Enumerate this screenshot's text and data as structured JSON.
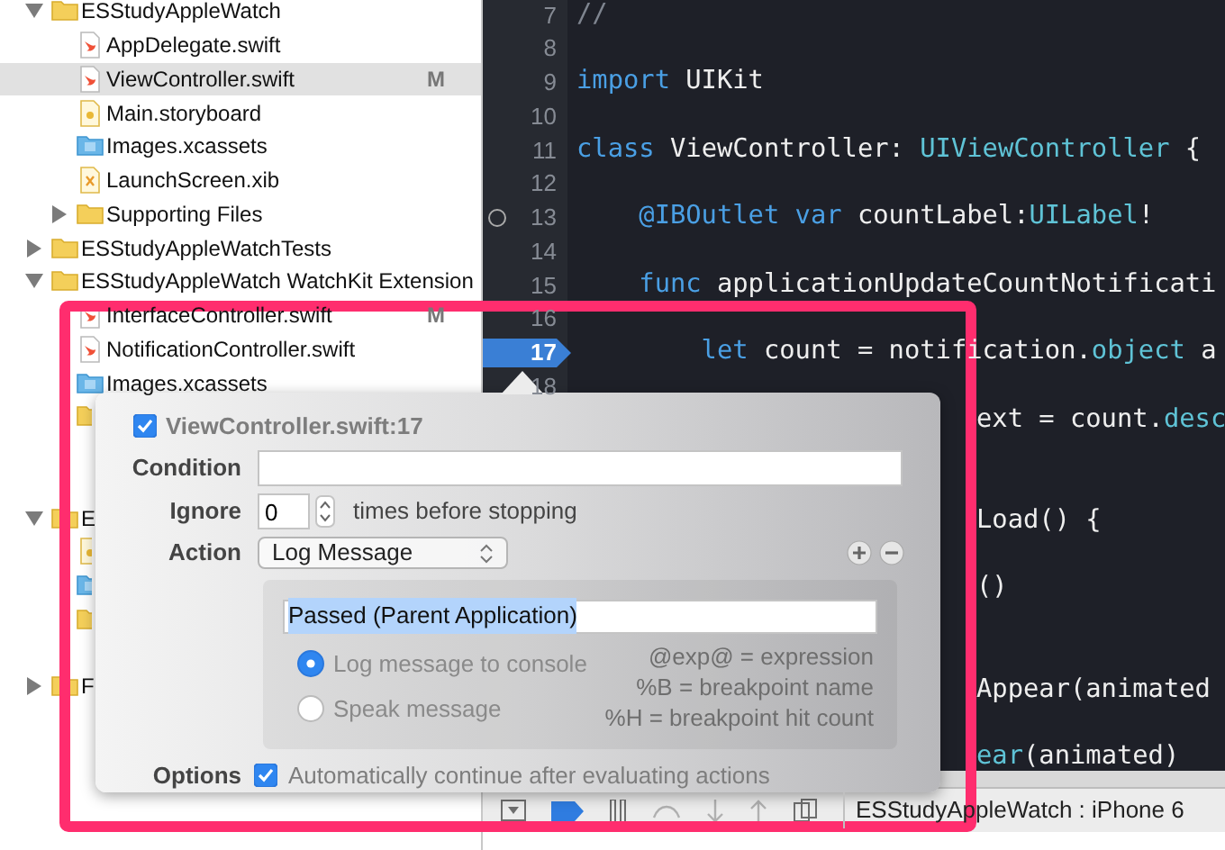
{
  "navigator": {
    "items": [
      {
        "kind": "folder",
        "label": "ESStudyAppleWatch",
        "expanded": true,
        "selected": false,
        "children": [
          {
            "kind": "swift",
            "label": "AppDelegate.swift",
            "selected": false
          },
          {
            "kind": "swift",
            "label": "ViewController.swift",
            "selected": true,
            "badge": "M"
          },
          {
            "kind": "storyboard",
            "label": "Main.storyboard",
            "selected": false
          },
          {
            "kind": "assets",
            "label": "Images.xcassets",
            "selected": false
          },
          {
            "kind": "xib",
            "label": "LaunchScreen.xib",
            "selected": false
          },
          {
            "kind": "folder",
            "label": "Supporting Files",
            "expanded": false,
            "selected": false
          }
        ]
      },
      {
        "kind": "folder",
        "label": "ESStudyAppleWatchTests",
        "expanded": false,
        "selected": false
      },
      {
        "kind": "folder",
        "label": "ESStudyAppleWatch WatchKit Extension",
        "expanded": true,
        "selected": false,
        "children": [
          {
            "kind": "swift",
            "label": "InterfaceController.swift",
            "selected": false,
            "badge": "M"
          },
          {
            "kind": "swift",
            "label": "NotificationController.swift",
            "selected": false
          },
          {
            "kind": "assets",
            "label": "Images.xcassets",
            "selected": false
          },
          {
            "kind": "folder",
            "selected": false
          }
        ]
      },
      {
        "kind": "folder",
        "label": "E",
        "expanded": true,
        "selected": false,
        "children": [
          {
            "kind": "storyboard",
            "selected": false
          },
          {
            "kind": "assets",
            "selected": false
          },
          {
            "kind": "folder",
            "selected": false
          }
        ]
      },
      {
        "kind": "folder",
        "label": "F",
        "expanded": false,
        "selected": false
      }
    ]
  },
  "editor": {
    "rows": [
      {
        "number": "7",
        "breakpoint": false,
        "tokens": [
          {
            "kind": "comment",
            "text": "//"
          }
        ]
      },
      {
        "number": "8",
        "breakpoint": false,
        "tokens": []
      },
      {
        "number": "9",
        "breakpoint": false,
        "tokens": [
          {
            "kind": "keyword",
            "text": "import"
          },
          {
            "kind": "plain",
            "text": " UIKit"
          }
        ]
      },
      {
        "number": "10",
        "breakpoint": false,
        "tokens": []
      },
      {
        "number": "11",
        "breakpoint": false,
        "tokens": [
          {
            "kind": "keyword",
            "text": "class"
          },
          {
            "kind": "plain",
            "text": " ViewController: "
          },
          {
            "kind": "type",
            "text": "UIViewController"
          },
          {
            "kind": "plain",
            "text": " {"
          }
        ]
      },
      {
        "number": "12",
        "breakpoint": false,
        "tokens": []
      },
      {
        "number": "13",
        "breakpoint": false,
        "outlet_connected": false,
        "tokens": [
          {
            "kind": "keyword",
            "text": "    @IBOutlet"
          },
          {
            "kind": "keyword",
            "text": " var"
          },
          {
            "kind": "plain",
            "text": " countLabel:"
          },
          {
            "kind": "type",
            "text": "UILabel"
          },
          {
            "kind": "plain",
            "text": "!"
          }
        ]
      },
      {
        "number": "14",
        "breakpoint": false,
        "tokens": []
      },
      {
        "number": "15",
        "breakpoint": false,
        "tokens": [
          {
            "kind": "keyword",
            "text": "    func"
          },
          {
            "kind": "plain",
            "text": " applicationUpdateCountNotificati"
          }
        ]
      },
      {
        "number": "16",
        "breakpoint": false,
        "tokens": []
      },
      {
        "number": "17",
        "breakpoint": true,
        "tokens": [
          {
            "kind": "keyword",
            "text": "        let"
          },
          {
            "kind": "plain",
            "text": " count = notification."
          },
          {
            "kind": "type",
            "text": "object"
          },
          {
            "kind": "plain",
            "text": " a"
          }
        ]
      },
      {
        "number": "18",
        "breakpoint": false,
        "tokens": []
      },
      {
        "tokens": [
          {
            "kind": "plain",
            "text": "ext = count."
          },
          {
            "kind": "type",
            "text": "desc"
          }
        ]
      },
      {
        "tokens": []
      },
      {
        "tokens": []
      },
      {
        "tokens": [
          {
            "kind": "plain",
            "text": "Load() {"
          }
        ]
      },
      {
        "tokens": []
      },
      {
        "tokens": [
          {
            "kind": "plain",
            "text": "()"
          }
        ]
      },
      {
        "tokens": []
      },
      {
        "tokens": []
      },
      {
        "tokens": [
          {
            "kind": "plain",
            "text": "Appear(animated"
          }
        ]
      },
      {
        "tokens": []
      },
      {
        "tokens": [
          {
            "kind": "type",
            "text": "ear"
          },
          {
            "kind": "plain",
            "text": "(animated)"
          }
        ]
      }
    ]
  },
  "debug_bar": {
    "scheme": "ESStudyAppleWatch : iPhone 6",
    "breakpoints_active": true
  },
  "breakpoint_popover": {
    "enabled": true,
    "title": "ViewController.swift:17",
    "condition": {
      "label": "Condition"
    },
    "ignore": {
      "label": "Ignore",
      "value": "0",
      "suffix": "times before stopping"
    },
    "action": {
      "label": "Action",
      "value": "Log Message"
    },
    "message": {
      "value": "Passed (Parent Application)"
    },
    "outputs": [
      {
        "label": "Log message to console",
        "selected": true
      },
      {
        "label": "Speak message",
        "selected": false
      }
    ],
    "hints": [
      "@exp@ = expression",
      "%B = breakpoint name",
      "%H = breakpoint hit count"
    ],
    "options": {
      "label": "Options",
      "checked": true,
      "text": "Automatically continue after evaluating actions"
    }
  }
}
